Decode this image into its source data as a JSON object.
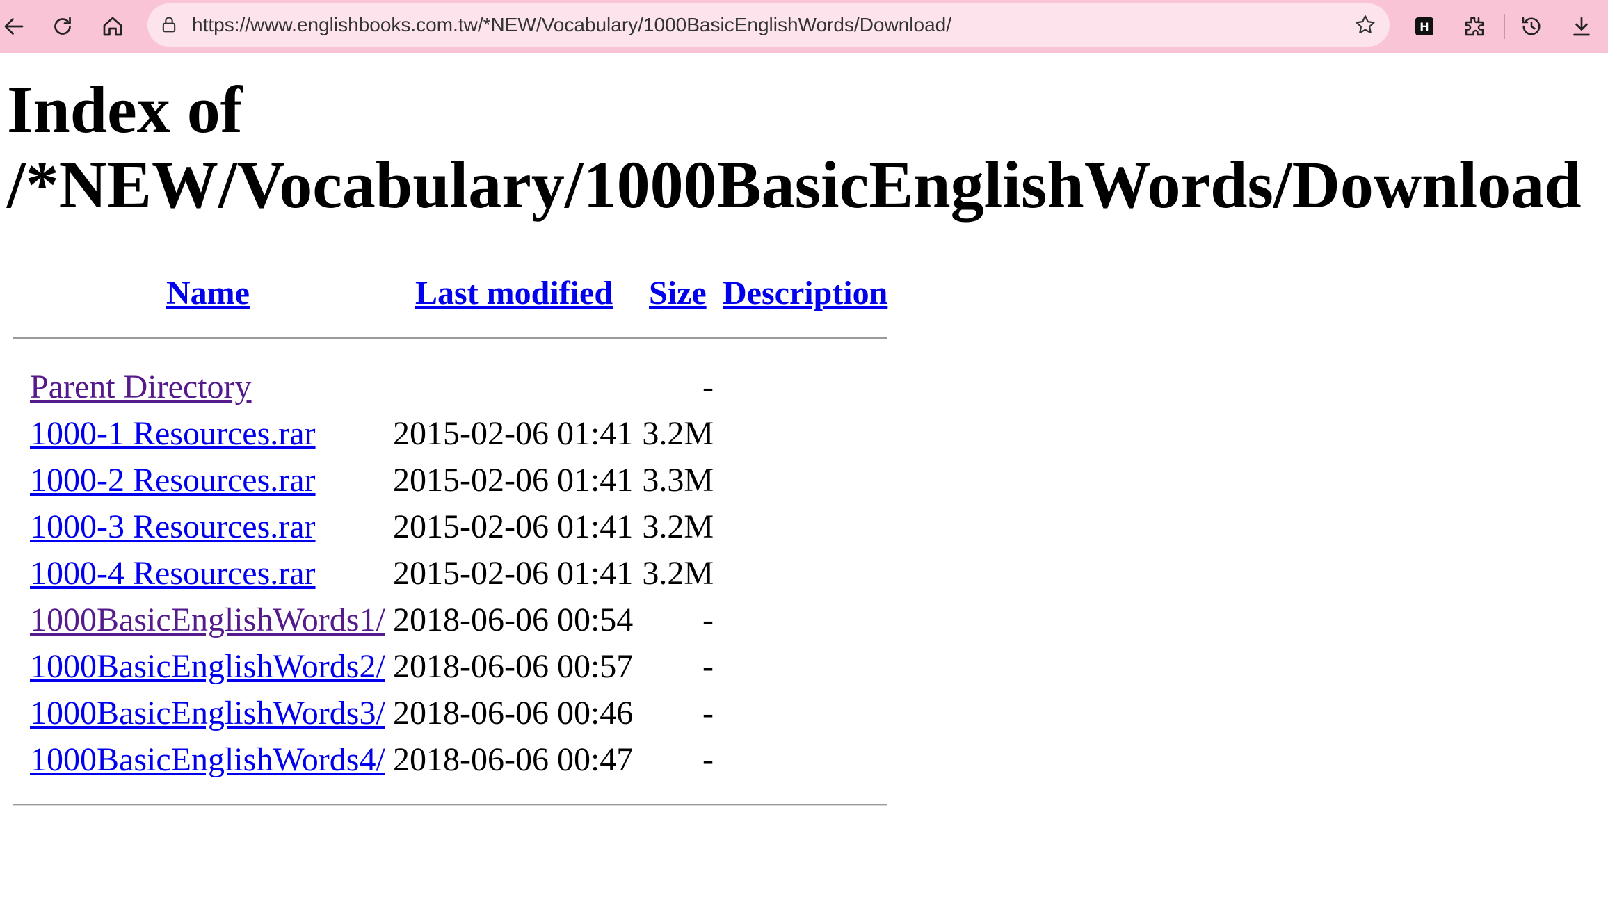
{
  "browser": {
    "url": "https://www.englishbooks.com.tw/*NEW/Vocabulary/1000BasicEnglishWords/Download/",
    "extension_badge": "H"
  },
  "page": {
    "title": "Index of /*NEW/Vocabulary/1000BasicEnglishWords/Download",
    "columns": {
      "name": "Name",
      "last_modified": "Last modified",
      "size": "Size",
      "description": "Description"
    },
    "rows": [
      {
        "name": "Parent Directory",
        "date": "",
        "size": "-",
        "visited": true
      },
      {
        "name": "1000-1 Resources.rar",
        "date": "2015-02-06 01:41",
        "size": "3.2M",
        "visited": false
      },
      {
        "name": "1000-2 Resources.rar",
        "date": "2015-02-06 01:41",
        "size": "3.3M",
        "visited": false
      },
      {
        "name": "1000-3 Resources.rar",
        "date": "2015-02-06 01:41",
        "size": "3.2M",
        "visited": false
      },
      {
        "name": "1000-4 Resources.rar",
        "date": "2015-02-06 01:41",
        "size": "3.2M",
        "visited": false
      },
      {
        "name": "1000BasicEnglishWords1/",
        "date": "2018-06-06 00:54",
        "size": "-",
        "visited": true
      },
      {
        "name": "1000BasicEnglishWords2/",
        "date": "2018-06-06 00:57",
        "size": "-",
        "visited": false
      },
      {
        "name": "1000BasicEnglishWords3/",
        "date": "2018-06-06 00:46",
        "size": "-",
        "visited": false
      },
      {
        "name": "1000BasicEnglishWords4/",
        "date": "2018-06-06 00:47",
        "size": "-",
        "visited": false
      }
    ]
  },
  "colors": {
    "toolbar": "#f9c4d6",
    "omnibox": "#fde4ec",
    "link": "#0000ee",
    "visited_link": "#551a8b"
  },
  "icons": [
    "back-icon",
    "reload-icon",
    "home-icon",
    "lock-icon",
    "star-icon",
    "extension-badge-icon",
    "puzzle-icon",
    "history-icon",
    "download-icon"
  ]
}
